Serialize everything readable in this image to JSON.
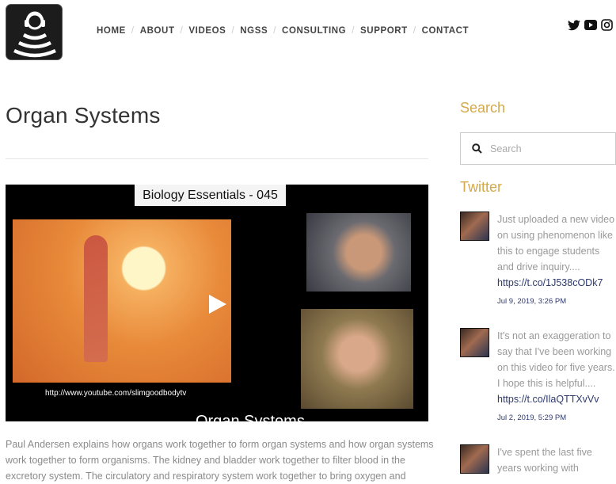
{
  "nav": {
    "items": [
      "HOME",
      "ABOUT",
      "VIDEOS",
      "NGSS",
      "CONSULTING",
      "SUPPORT",
      "CONTACT"
    ]
  },
  "social": [
    "twitter-icon",
    "youtube-icon",
    "instagram-icon"
  ],
  "page": {
    "title": "Organ Systems"
  },
  "video": {
    "banner": "Biology Essentials - 045",
    "url": "http://www.youtube.com/slimgoodbodytv",
    "caption": "Organ Systems"
  },
  "description": "Paul Andersen explains how organs work together to form organ systems and how organ systems work together to form organisms. The kidney and bladder work together to filter blood in the excretory system. The circulatory and respiratory system work together to bring oxygen and",
  "sidebar": {
    "search_heading": "Search",
    "search_placeholder": "Search",
    "twitter_heading": "Twitter",
    "tweets": [
      {
        "text": "Just uploaded a new video on using phenomenon like this to engage students and drive inquiry....",
        "link": "https://t.co/1J538cODk7",
        "date": "Jul 9, 2019, 3:26 PM"
      },
      {
        "text": "It's not an exaggeration to say that I've been working on this video for five years. I hope this is helpful....",
        "link": "https://t.co/IlaQTTXvVv",
        "date": "Jul 2, 2019, 5:29 PM"
      },
      {
        "text": "I've spent the last five years working with",
        "link": "",
        "date": ""
      }
    ]
  },
  "colors": {
    "accent": "#d4a94a",
    "link": "#2e3a6e"
  }
}
